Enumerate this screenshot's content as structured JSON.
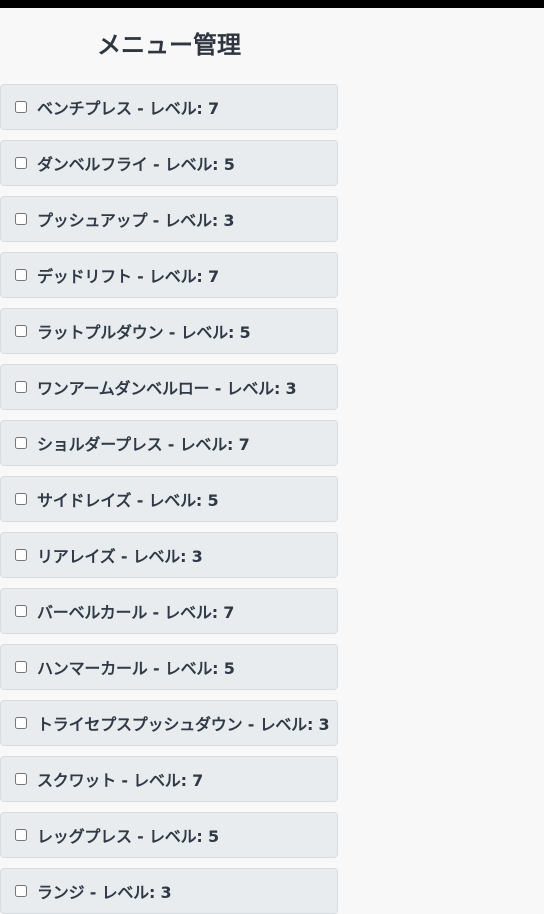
{
  "title": "メニュー管理",
  "items": [
    {
      "label": "ベンチプレス - レベル: 7",
      "checked": false
    },
    {
      "label": "ダンベルフライ - レベル: 5",
      "checked": false
    },
    {
      "label": "プッシュアップ - レベル: 3",
      "checked": false
    },
    {
      "label": "デッドリフト - レベル: 7",
      "checked": false
    },
    {
      "label": "ラットプルダウン - レベル: 5",
      "checked": false
    },
    {
      "label": "ワンアームダンベルロー - レベル: 3",
      "checked": false
    },
    {
      "label": "ショルダープレス - レベル: 7",
      "checked": false
    },
    {
      "label": "サイドレイズ - レベル: 5",
      "checked": false
    },
    {
      "label": "リアレイズ - レベル: 3",
      "checked": false
    },
    {
      "label": "バーベルカール - レベル: 7",
      "checked": false
    },
    {
      "label": "ハンマーカール - レベル: 5",
      "checked": false
    },
    {
      "label": "トライセプスプッシュダウン - レベル: 3",
      "checked": false
    },
    {
      "label": "スクワット - レベル: 7",
      "checked": false
    },
    {
      "label": "レッグプレス - レベル: 5",
      "checked": false
    },
    {
      "label": "ランジ - レベル: 3",
      "checked": false
    }
  ]
}
